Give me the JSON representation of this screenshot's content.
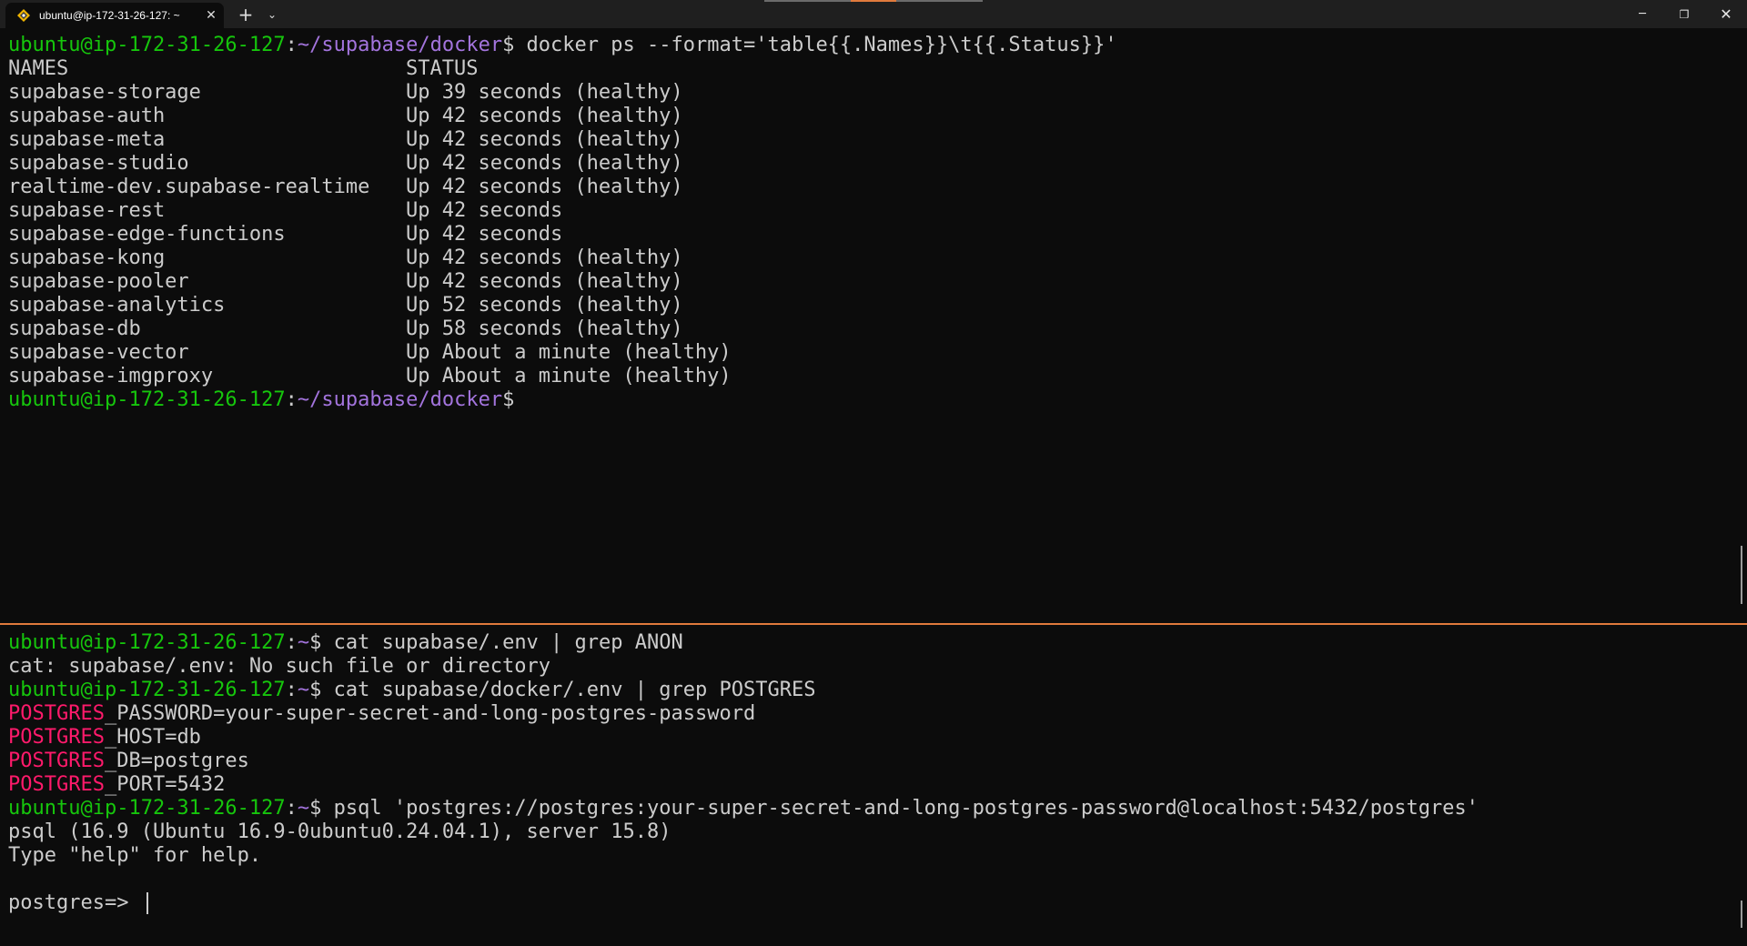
{
  "titlebar": {
    "tab_title": "ubuntu@ip-172-31-26-127: ~",
    "tab_icon": "linux-penguin-icon",
    "close_tab": "✕",
    "new_tab": "+",
    "dropdown": "⌄",
    "window_controls": {
      "minimize": "─",
      "maximize": "❐",
      "close": "✕"
    }
  },
  "colors": {
    "background": "#0c0c0c",
    "prompt_user": "#16c60c",
    "prompt_path": "#a374dd",
    "grep_match": "#ff1a6b",
    "divider": "#e07a3c"
  },
  "top_pane": {
    "prompt_user": "ubuntu@ip-172-31-26-127",
    "prompt_sep": ":",
    "prompt_path": "~/supabase/docker",
    "prompt_char": "$",
    "command": " docker ps --format='table{{.Names}}\\t{{.Status}}'",
    "header": {
      "names": "NAMES",
      "status": "STATUS"
    },
    "rows": [
      {
        "name": "supabase-storage",
        "status": "Up 39 seconds (healthy)"
      },
      {
        "name": "supabase-auth",
        "status": "Up 42 seconds (healthy)"
      },
      {
        "name": "supabase-meta",
        "status": "Up 42 seconds (healthy)"
      },
      {
        "name": "supabase-studio",
        "status": "Up 42 seconds (healthy)"
      },
      {
        "name": "realtime-dev.supabase-realtime",
        "status": "Up 42 seconds (healthy)"
      },
      {
        "name": "supabase-rest",
        "status": "Up 42 seconds"
      },
      {
        "name": "supabase-edge-functions",
        "status": "Up 42 seconds"
      },
      {
        "name": "supabase-kong",
        "status": "Up 42 seconds (healthy)"
      },
      {
        "name": "supabase-pooler",
        "status": "Up 42 seconds (healthy)"
      },
      {
        "name": "supabase-analytics",
        "status": "Up 52 seconds (healthy)"
      },
      {
        "name": "supabase-db",
        "status": "Up 58 seconds (healthy)"
      },
      {
        "name": "supabase-vector",
        "status": "Up About a minute (healthy)"
      },
      {
        "name": "supabase-imgproxy",
        "status": "Up About a minute (healthy)"
      }
    ]
  },
  "bottom_pane": {
    "prompt_user": "ubuntu@ip-172-31-26-127",
    "prompt_sep": ":",
    "prompt_path": "~",
    "prompt_char": "$",
    "cmd1": " cat supabase/.env | grep ANON",
    "out1": "cat: supabase/.env: No such file or directory",
    "cmd2": " cat supabase/docker/.env | grep POSTGRES",
    "match_word": "POSTGRES",
    "env_rest": [
      "_PASSWORD=your-super-secret-and-long-postgres-password",
      "_HOST=db",
      "_DB=postgres",
      "_PORT=5432"
    ],
    "cmd3": " psql 'postgres://postgres:your-super-secret-and-long-postgres-password@localhost:5432/postgres'",
    "out3a": "psql (16.9 (Ubuntu 16.9-0ubuntu0.24.04.1), server 15.8)",
    "out3b": "Type \"help\" for help.",
    "psql_prompt": "postgres=> "
  }
}
